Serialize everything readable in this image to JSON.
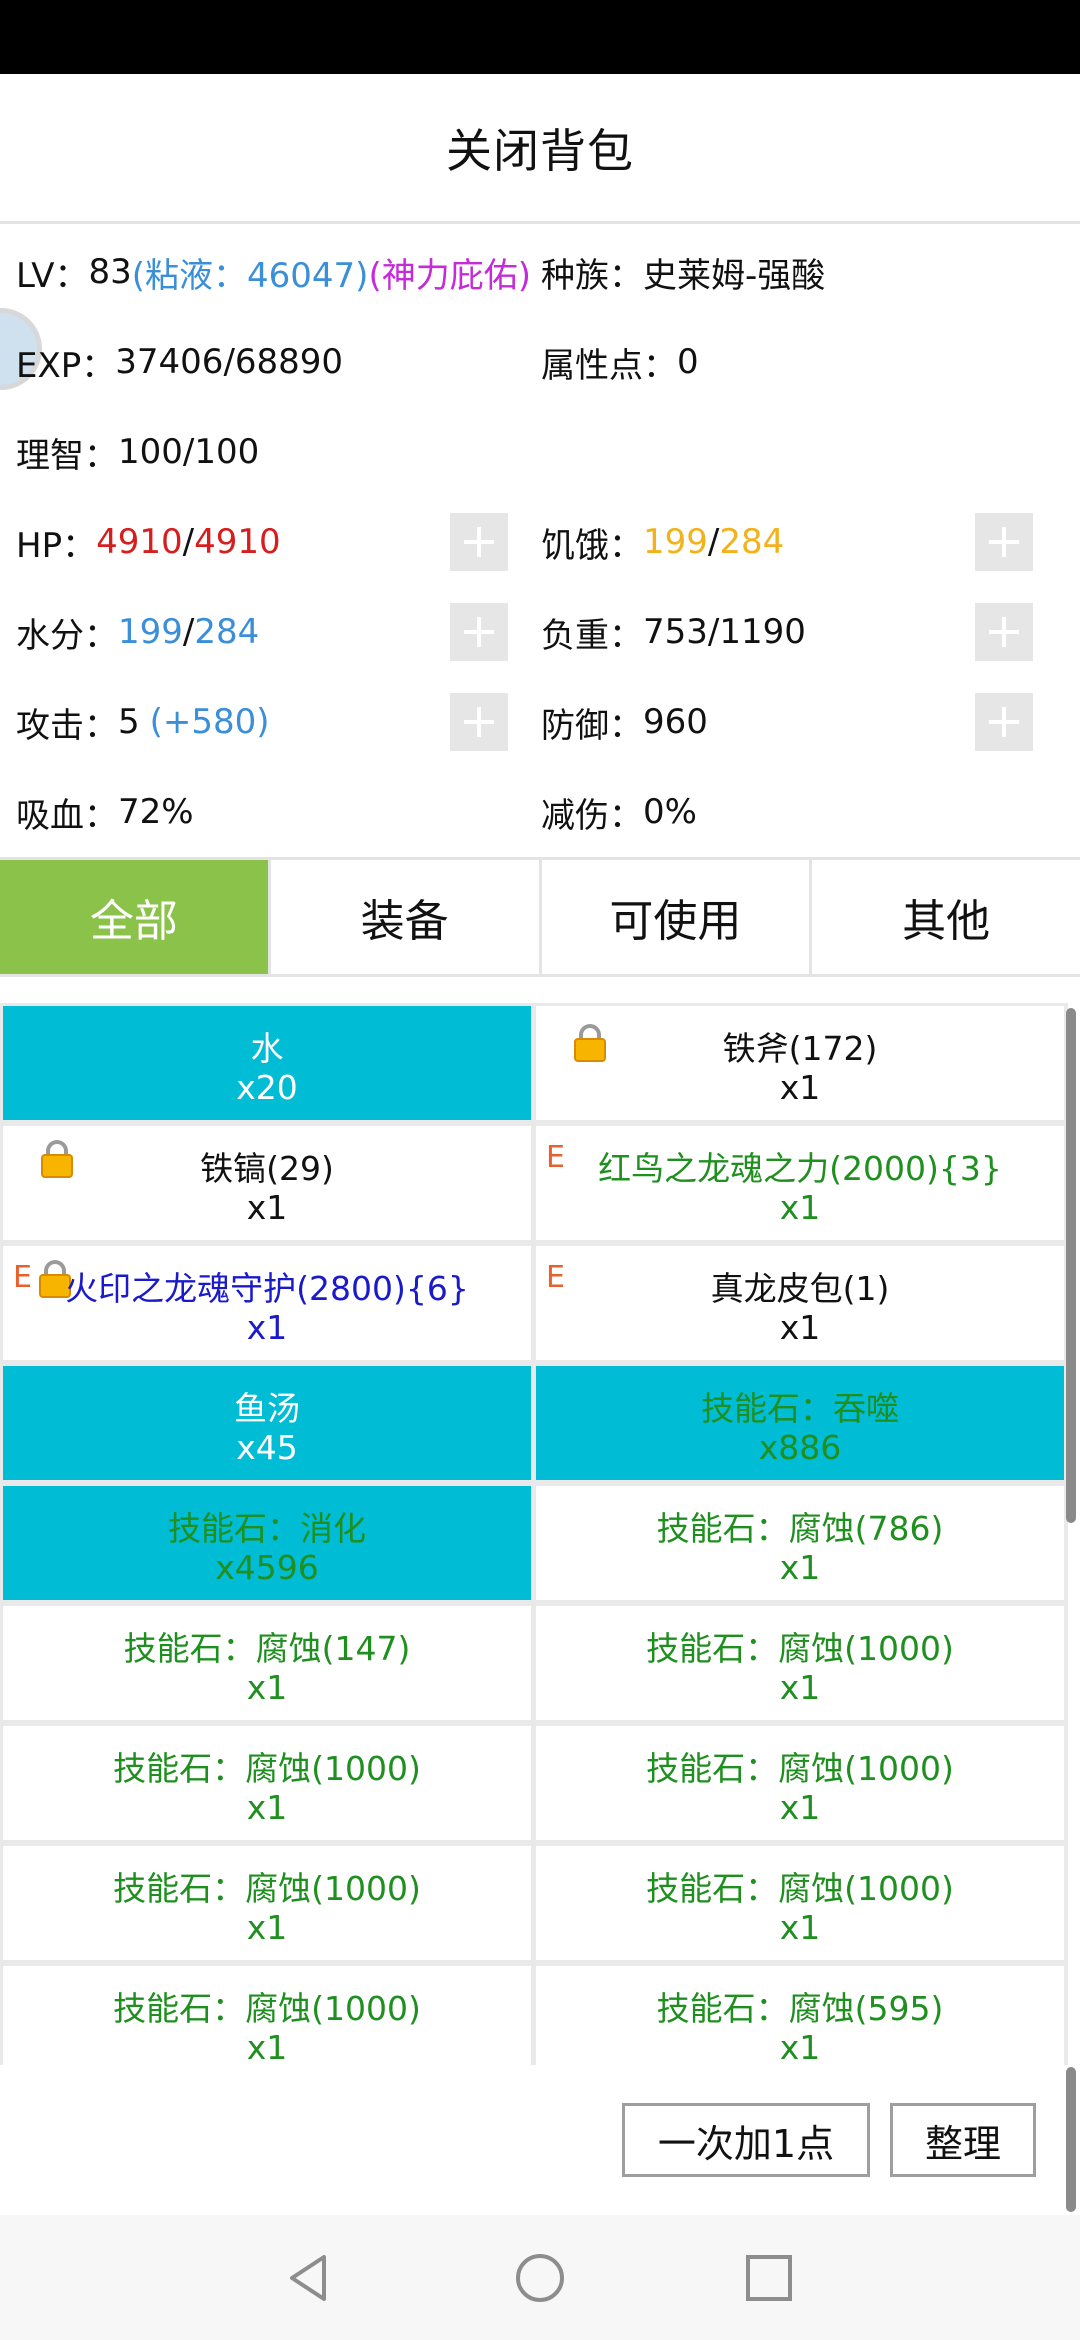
{
  "header": {
    "title": "关闭背包"
  },
  "stats": {
    "lv_label": "LV：",
    "lv_value": "83",
    "lv_slime": "(粘液：46047)",
    "lv_blessing": "(神力庇佑)",
    "race_label": "种族：",
    "race_value": "史莱姆-强酸",
    "exp_label": "EXP：",
    "exp_value": "37406/68890",
    "attr_label": "属性点：",
    "attr_value": "0",
    "sanity_label": "理智：",
    "sanity_value": "100/100",
    "hp_label": "HP：",
    "hp_current": "4910",
    "hp_sep": "/",
    "hp_max": "4910",
    "hunger_label": "饥饿：",
    "hunger_current": "199",
    "hunger_sep": "/",
    "hunger_max": "284",
    "water_label": "水分：",
    "water_current": "199",
    "water_sep": "/",
    "water_max": "284",
    "load_label": "负重：",
    "load_value": "753/1190",
    "attack_label": "攻击：",
    "attack_value": "5",
    "attack_bonus": "(+580)",
    "defense_label": "防御：",
    "defense_value": "960",
    "lifesteal_label": "吸血：",
    "lifesteal_value": "72%",
    "reduction_label": "减伤：",
    "reduction_value": "0%"
  },
  "tabs": [
    {
      "label": "全部",
      "active": true
    },
    {
      "label": "装备",
      "active": false
    },
    {
      "label": "可使用",
      "active": false
    },
    {
      "label": "其他",
      "active": false
    }
  ],
  "inventory": [
    {
      "name": "水",
      "qty": "x20"
    },
    {
      "name": "铁斧(172)",
      "qty": "x1"
    },
    {
      "name": "铁镐(29)",
      "qty": "x1"
    },
    {
      "name": "红鸟之龙魂之力(2000){3}",
      "qty": "x1",
      "mark": "E"
    },
    {
      "name": "火印之龙魂守护(2800){6}",
      "qty": "x1",
      "mark": "E"
    },
    {
      "name": "真龙皮包(1)",
      "qty": "x1",
      "mark": "E"
    },
    {
      "name": "鱼汤",
      "qty": "x45"
    },
    {
      "name": "技能石：吞噬",
      "qty": "x886"
    },
    {
      "name": "技能石：消化",
      "qty": "x4596"
    },
    {
      "name": "技能石：腐蚀(786)",
      "qty": "x1"
    },
    {
      "name": "技能石：腐蚀(147)",
      "qty": "x1"
    },
    {
      "name": "技能石：腐蚀(1000)",
      "qty": "x1"
    },
    {
      "name": "技能石：腐蚀(1000)",
      "qty": "x1"
    },
    {
      "name": "技能石：腐蚀(1000)",
      "qty": "x1"
    },
    {
      "name": "技能石：腐蚀(1000)",
      "qty": "x1"
    },
    {
      "name": "技能石：腐蚀(1000)",
      "qty": "x1"
    },
    {
      "name": "技能石：腐蚀(1000)",
      "qty": "x1"
    },
    {
      "name": "技能石：腐蚀(595)",
      "qty": "x1"
    }
  ],
  "bottom": {
    "add_one_label": "一次加1点",
    "sort_label": "整理"
  },
  "colors": {
    "tab_active": "#8bc34a",
    "item_highlight": "#00bcd4",
    "skill_text": "#1f8f1f",
    "equip_text": "#1a1acb",
    "hp_text": "#d71e1e",
    "hunger_text": "#f2b21c",
    "water_text": "#3a8fd8"
  },
  "icons": {
    "lock": "lock-icon",
    "plus": "plus-icon",
    "nav_back": "back-triangle-icon",
    "nav_home": "home-circle-icon",
    "nav_recent": "recent-square-icon"
  }
}
